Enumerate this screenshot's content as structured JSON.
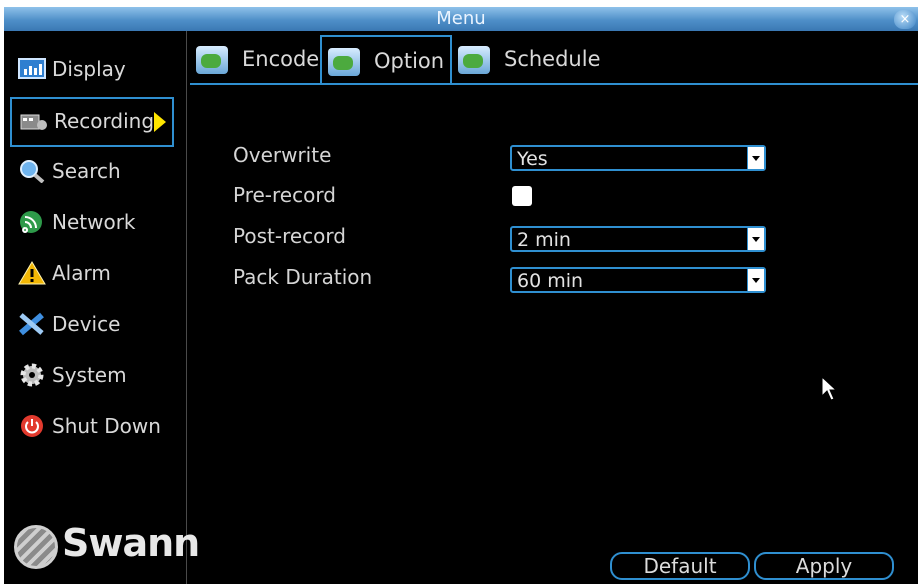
{
  "window": {
    "title": "Menu",
    "close_glyph": "×"
  },
  "sidebar": {
    "items": [
      {
        "label": "Display",
        "icon": "display-icon"
      },
      {
        "label": "Recording",
        "icon": "recording-icon",
        "active": true
      },
      {
        "label": "Search",
        "icon": "search-icon"
      },
      {
        "label": "Network",
        "icon": "network-icon"
      },
      {
        "label": "Alarm",
        "icon": "alarm-icon"
      },
      {
        "label": "Device",
        "icon": "device-icon"
      },
      {
        "label": "System",
        "icon": "system-icon"
      },
      {
        "label": "Shut Down",
        "icon": "power-icon"
      }
    ],
    "logo_text": "Swann"
  },
  "tabs": [
    {
      "label": "Encode"
    },
    {
      "label": "Option",
      "active": true
    },
    {
      "label": "Schedule"
    }
  ],
  "form": {
    "overwrite": {
      "label": "Overwrite",
      "value": "Yes"
    },
    "prerecord": {
      "label": "Pre-record",
      "checked": false
    },
    "postrecord": {
      "label": "Post-record",
      "value": "2 min"
    },
    "pack_duration": {
      "label": "Pack Duration",
      "value": "60 min"
    }
  },
  "buttons": {
    "default_label": "Default",
    "apply_label": "Apply"
  },
  "colors": {
    "accent": "#2f8fd0",
    "background": "#000000",
    "title_bar": "#4f8fd0",
    "active_arrow": "#ffe600"
  }
}
